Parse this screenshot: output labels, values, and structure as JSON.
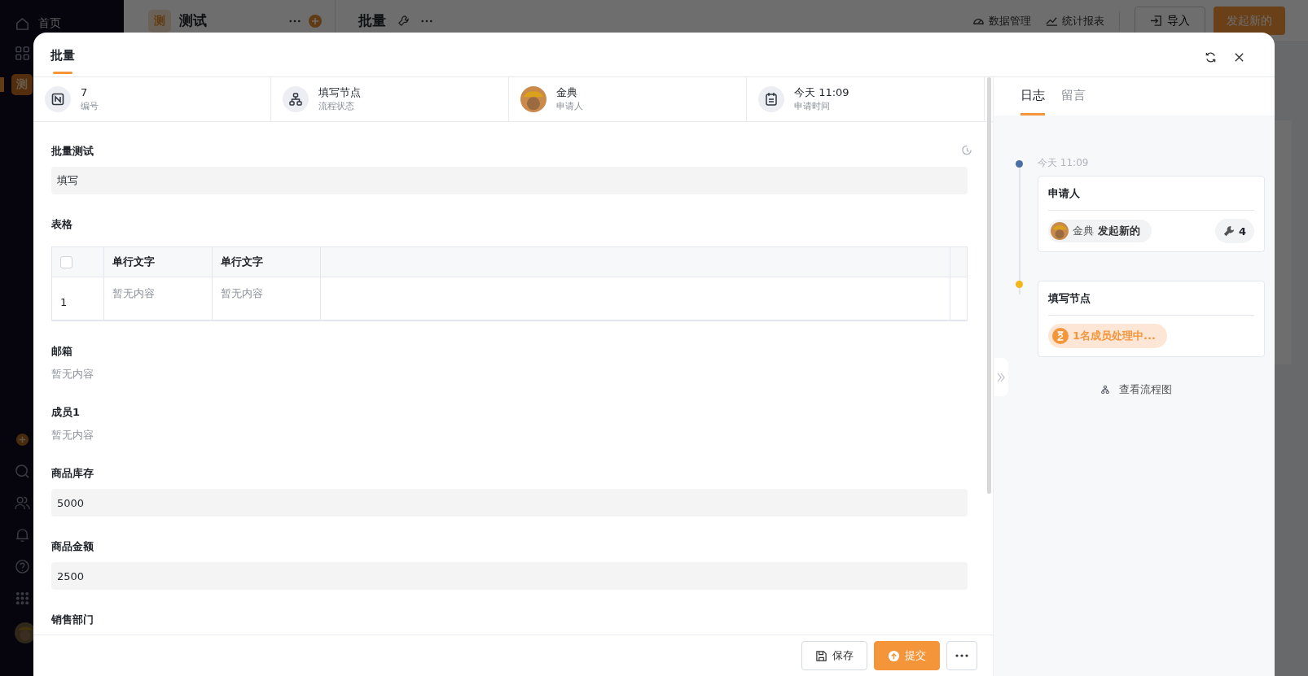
{
  "sidebar": {
    "items": [
      {
        "label": "首页"
      }
    ],
    "app_tile": "测"
  },
  "app_header": {
    "app_tile": "测",
    "app_name": "测试",
    "page_title": "批量",
    "links": [
      "数据管理",
      "统计报表"
    ],
    "import_button": "导入",
    "create_button": "发起新的"
  },
  "modal": {
    "title": "批量",
    "summary": [
      {
        "kind": "number",
        "value": "7",
        "label": "编号"
      },
      {
        "kind": "status",
        "value": "填写节点",
        "label": "流程状态"
      },
      {
        "kind": "person",
        "value": "金典",
        "label": "申请人"
      },
      {
        "kind": "time",
        "value": "今天 11:09",
        "label": "申请时间"
      }
    ],
    "fields": [
      {
        "kind": "input",
        "label": "批量测试",
        "value": "填写"
      },
      {
        "kind": "table",
        "label": "表格",
        "select_all_checked": false,
        "columns": [
          "单行文字",
          "单行文字"
        ],
        "rows": [
          {
            "index": "1",
            "cells": [
              "暂无内容",
              "暂无内容"
            ]
          }
        ]
      },
      {
        "kind": "text",
        "label": "邮箱",
        "value": "暂无内容"
      },
      {
        "kind": "text",
        "label": "成员1",
        "value": "暂无内容"
      },
      {
        "kind": "input",
        "label": "商品库存",
        "value": "5000"
      },
      {
        "kind": "input",
        "label": "商品金额",
        "value": "2500"
      },
      {
        "kind": "text",
        "label": "销售部门"
      }
    ],
    "footer": {
      "save_button": "保存",
      "submit_button": "提交"
    },
    "side_panel": {
      "tabs": [
        {
          "label": "日志",
          "selected": true
        },
        {
          "label": "留言",
          "selected": false
        }
      ],
      "timeline": [
        {
          "kind": "applicant",
          "color": "#4a6fa5",
          "time": "今天 11:09",
          "title": "申请人",
          "user": "金典",
          "action": "发起新的",
          "count": "4"
        },
        {
          "kind": "pending",
          "color": "#f5b51c",
          "title": "填写节点",
          "status": "1名成员处理中..."
        }
      ],
      "flow_link": "查看流程图"
    }
  }
}
